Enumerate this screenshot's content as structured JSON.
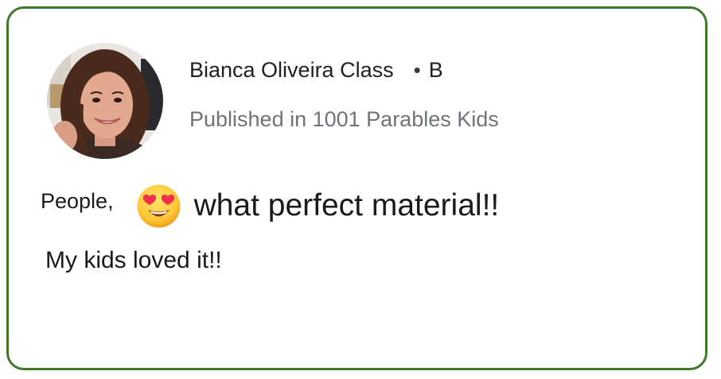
{
  "post": {
    "author_name": "Bianca Oliveira Class",
    "separator": "•",
    "badge_letter": "B",
    "publication": "Published in 1001 Parables Kids",
    "line_one_prefix": "People,",
    "emoji": "smiling-face-with-heart-eyes-icon",
    "line_one_text": "what perfect material!!",
    "line_two": "My kids loved it!!"
  },
  "colors": {
    "border": "#3f7a2a",
    "publication_text": "#6f7378",
    "body_text": "#1a1a1a"
  }
}
